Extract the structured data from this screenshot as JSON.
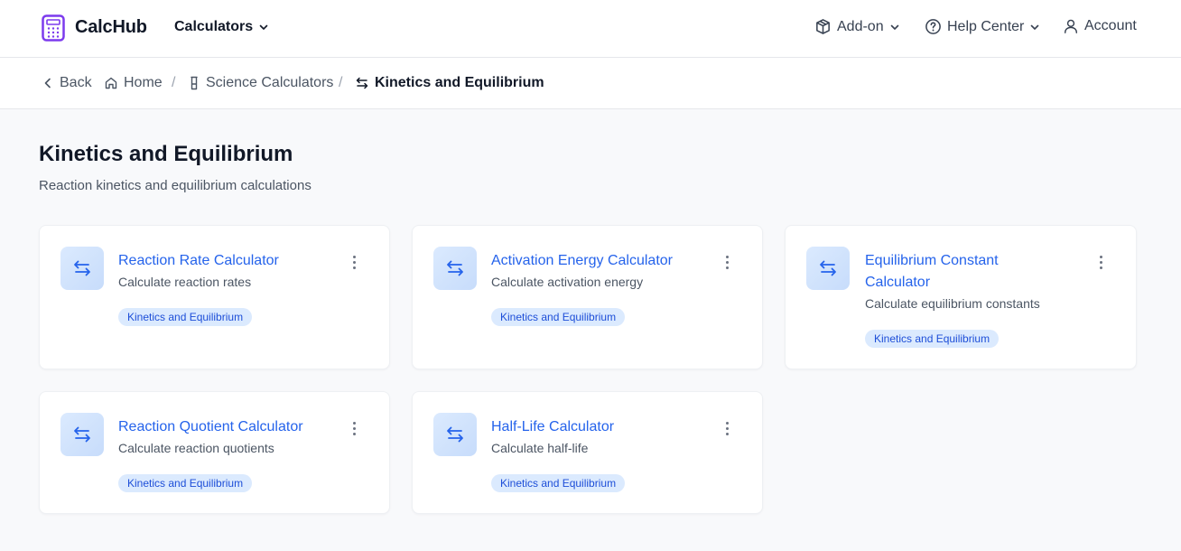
{
  "header": {
    "brand": "CalcHub",
    "calculators_menu": "Calculators",
    "addon": "Add-on",
    "help_center": "Help Center",
    "account": "Account"
  },
  "breadcrumb": {
    "back": "Back",
    "home": "Home",
    "science": "Science Calculators",
    "current": "Kinetics and Equilibrium",
    "separator": "/"
  },
  "page": {
    "title": "Kinetics and Equilibrium",
    "subtitle": "Reaction kinetics and equilibrium calculations"
  },
  "cards": [
    {
      "title": "Reaction Rate Calculator",
      "description": "Calculate reaction rates",
      "tag": "Kinetics and Equilibrium",
      "icon": "swap-arrows-icon"
    },
    {
      "title": "Activation Energy Calculator",
      "description": "Calculate activation energy",
      "tag": "Kinetics and Equilibrium",
      "icon": "swap-arrows-icon"
    },
    {
      "title": "Equilibrium Constant Calculator",
      "description": "Calculate equilibrium constants",
      "tag": "Kinetics and Equilibrium",
      "icon": "swap-arrows-icon"
    },
    {
      "title": "Reaction Quotient Calculator",
      "description": "Calculate reaction quotients",
      "tag": "Kinetics and Equilibrium",
      "icon": "swap-arrows-icon"
    },
    {
      "title": "Half-Life Calculator",
      "description": "Calculate half-life",
      "tag": "Kinetics and Equilibrium",
      "icon": "swap-arrows-icon"
    }
  ],
  "colors": {
    "accent": "#2563eb",
    "tag_bg": "#dbeafe",
    "logo": "#7c3aed",
    "page_bg": "#f8f9fb"
  }
}
